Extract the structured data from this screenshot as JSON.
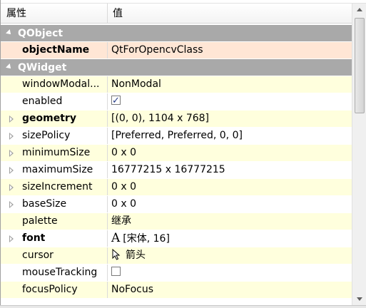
{
  "header": {
    "property": "属性",
    "value": "值"
  },
  "categories": {
    "qobject": "QObject",
    "qwidget": "QWidget"
  },
  "rows": {
    "objectName": {
      "name": "objectName",
      "value": "QtForOpencvClass"
    },
    "windowModality": {
      "name": "windowModal...",
      "value": "NonModal"
    },
    "enabled": {
      "name": "enabled",
      "checked": true
    },
    "geometry": {
      "name": "geometry",
      "value": "[(0, 0), 1104 x 768]"
    },
    "sizePolicy": {
      "name": "sizePolicy",
      "value": "[Preferred, Preferred, 0, 0]"
    },
    "minimumSize": {
      "name": "minimumSize",
      "value": "0 x 0"
    },
    "maximumSize": {
      "name": "maximumSize",
      "value": "16777215 x 16777215"
    },
    "sizeIncrement": {
      "name": "sizeIncrement",
      "value": "0 x 0"
    },
    "baseSize": {
      "name": "baseSize",
      "value": "0 x 0"
    },
    "palette": {
      "name": "palette",
      "value": "继承"
    },
    "font": {
      "name": "font",
      "icon": "A",
      "value": "[宋体, 16]"
    },
    "cursor": {
      "name": "cursor",
      "value": "箭头"
    },
    "mouseTracking": {
      "name": "mouseTracking",
      "checked": false
    },
    "focusPolicy": {
      "name": "focusPolicy",
      "value": "NoFocus"
    }
  },
  "colors": {
    "category_bg": "#a9a9a9",
    "row_yellow": "#ffffdd",
    "row_selected": "#ffe6d5"
  }
}
